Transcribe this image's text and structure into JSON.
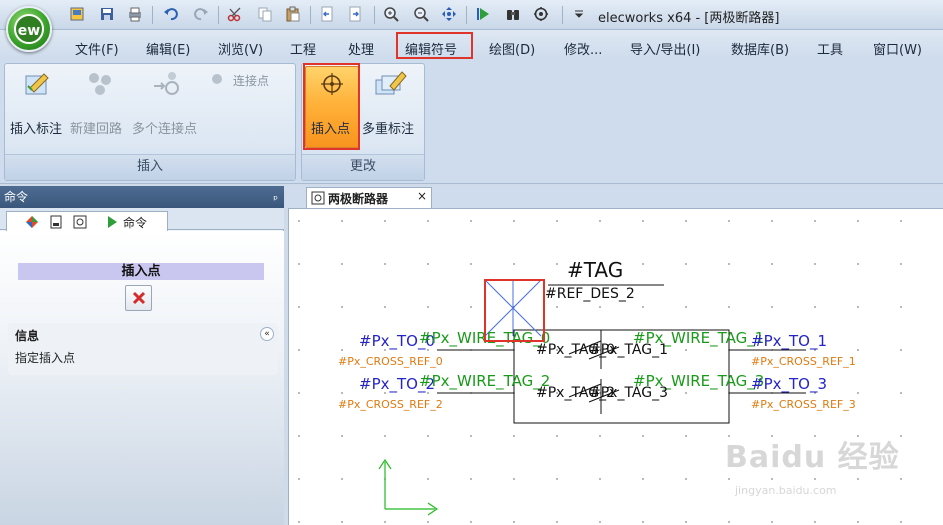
{
  "window": {
    "title": "elecworks x64 - [两极断路器]",
    "app_logo": "ew"
  },
  "quick_access": [
    "app-icon",
    "save-icon",
    "print-icon",
    "undo-icon",
    "redo-icon",
    "cut-icon",
    "copy-icon",
    "paste-icon",
    "page-prev-icon",
    "page-next-icon",
    "zoom-in-icon",
    "zoom-out-icon",
    "pan-icon",
    "run-icon",
    "binoculars-icon",
    "settings-icon",
    "dropdown-icon"
  ],
  "menu": {
    "items": [
      "文件(F)",
      "编辑(E)",
      "浏览(V)",
      "工程",
      "处理",
      "编辑符号",
      "绘图(D)",
      "修改...",
      "导入/导出(I)",
      "数据库(B)",
      "工具",
      "窗口(W)"
    ],
    "highlighted": "编辑符号"
  },
  "ribbon": {
    "groups": [
      {
        "label": "插入",
        "buttons": [
          "插入标注",
          "新建回路",
          "多个连接点"
        ],
        "small_button": "连接点"
      },
      {
        "label": "更改",
        "buttons": [
          "插入点",
          "多重标注"
        ]
      }
    ],
    "active_button": "插入点"
  },
  "left_panel": {
    "header": "命令",
    "pin": "ᵖ",
    "tab_label": "命令",
    "command_title": "插入点",
    "info_title": "信息",
    "info_text": "指定插入点",
    "collapse": "«"
  },
  "document": {
    "tab_title": "两极断路器",
    "tab_close": "×",
    "symbol": {
      "tag": "#TAG",
      "ref_des": "#REF_DES_2",
      "left_top": {
        "px_to": "#Px_TO_0",
        "wire_tag": "#Px_WIRE_TAG_0",
        "cross_ref": "#Px_CROSS_REF_0"
      },
      "left_bottom": {
        "px_to": "#Px_TO_2",
        "wire_tag": "#Px_WIRE_TAG_2",
        "cross_ref": "#Px_CROSS_REF_2"
      },
      "right_top": {
        "px_to": "#Px_TO_1",
        "wire_tag": "#Px_WIRE_TAG_1",
        "cross_ref": "#Px_CROSS_REF_1"
      },
      "right_bottom": {
        "px_to": "#Px_TO_3",
        "wire_tag": "#Px_WIRE_TAG_3",
        "cross_ref": "#Px_CROSS_REF_3"
      },
      "inner_top": "#Px_TAG_0",
      "inner_top_b": "#Px_TAG_1",
      "inner_bottom": "#Px_TAG_2",
      "inner_bottom_b": "#Px_TAG_3"
    }
  },
  "watermark": {
    "brand": "Baidu 经验",
    "url": "jingyan.baidu.com"
  },
  "colors": {
    "highlight": "#e0342a",
    "active_button": "#f7941e",
    "wire_tag_text": "#1a9a1a",
    "px_to_text": "#2424c8",
    "cross_ref_text": "#e07a10"
  }
}
